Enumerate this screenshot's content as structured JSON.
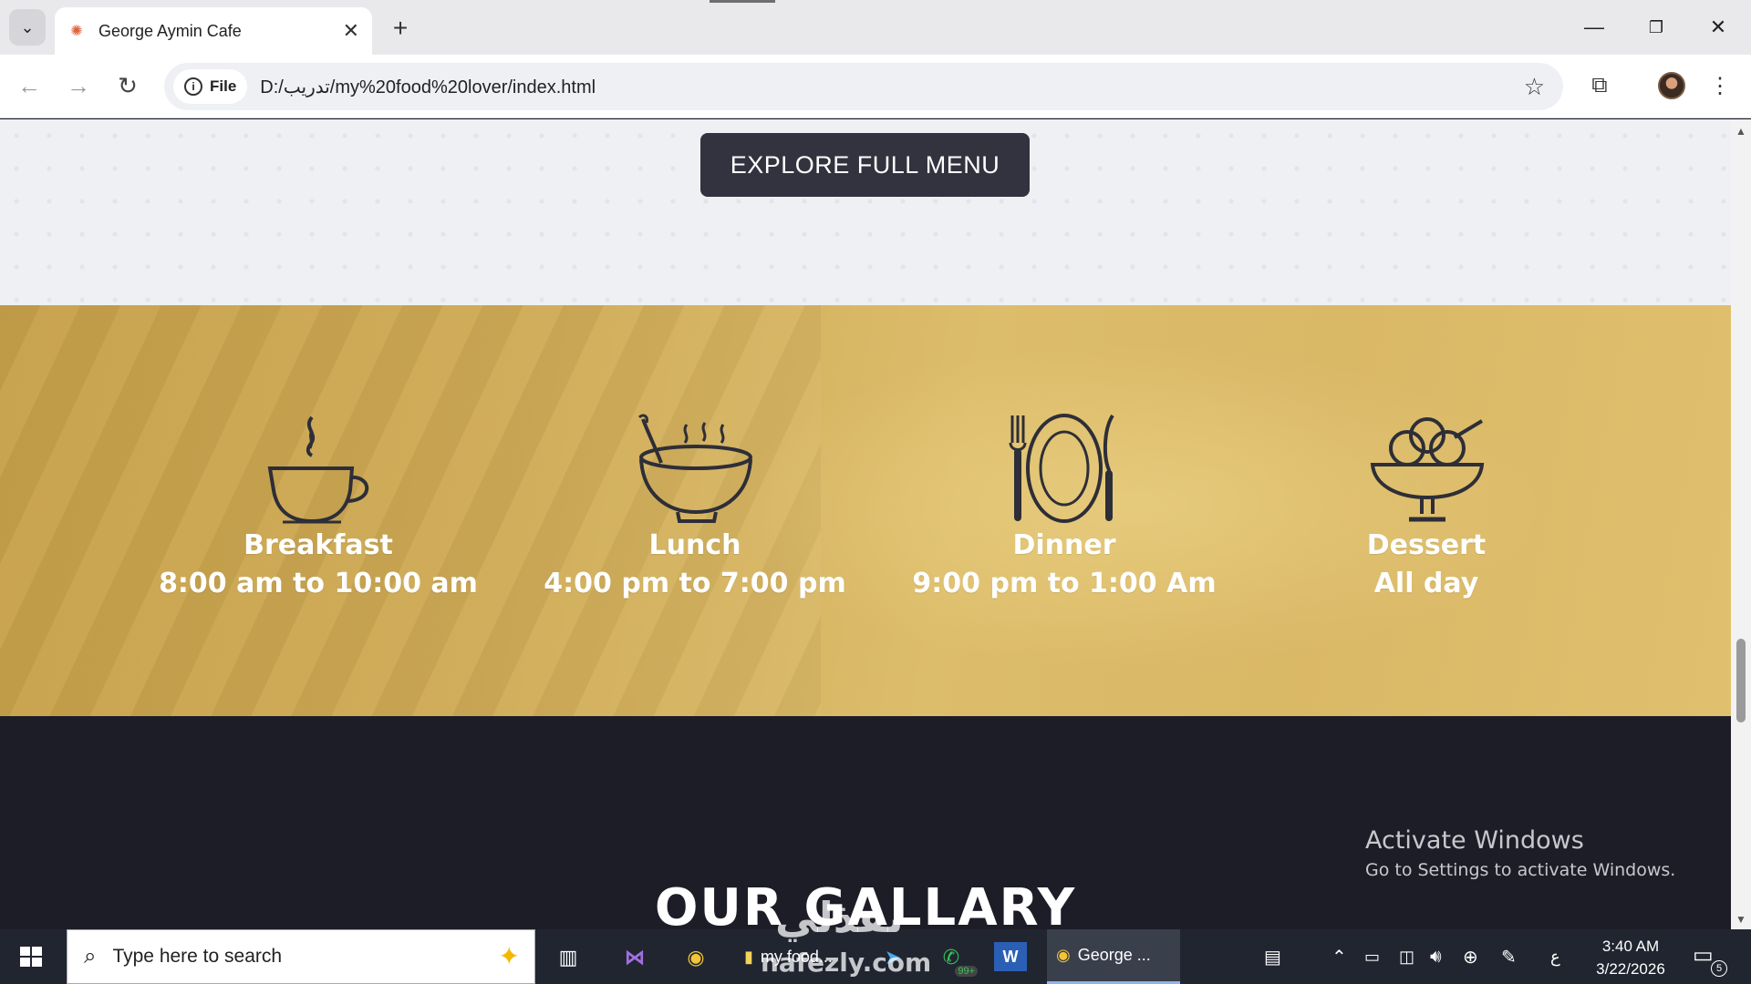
{
  "browser": {
    "tab_title": "George Aymin Cafe",
    "url_chip": "File",
    "url": "D:/تدريب/my%20food%20lover/index.html"
  },
  "page": {
    "explore_button": "EXPLORE FULL MENU",
    "hours": [
      {
        "icon": "coffee-cup-icon",
        "name": "Breakfast",
        "time": "8:00 am to 10:00 am"
      },
      {
        "icon": "soup-bowl-icon",
        "name": "Lunch",
        "time": "4:00 pm to 7:00 pm"
      },
      {
        "icon": "plate-cutlery-icon",
        "name": "Dinner",
        "time": "9:00 pm to 1:00 Am"
      },
      {
        "icon": "ice-cream-bowl-icon",
        "name": "Dessert",
        "time": "All day"
      }
    ],
    "gallery_title": "OUR GALLARY"
  },
  "os_overlay": {
    "activate_title": "Activate Windows",
    "activate_sub": "Go to Settings to activate Windows.",
    "watermark_ar": "نفذلي",
    "watermark_en": "nafezly.com"
  },
  "taskbar": {
    "search_placeholder": "Type here to search",
    "app_folder_label": "my food...",
    "app_chrome_label": "George ...",
    "whatsapp_badge": "99+",
    "lang": "ع",
    "time": "3:40 AM",
    "date": "3/22/2026",
    "notification_count": "5"
  },
  "colors": {
    "hours_band": "#d2b05c",
    "dark_band": "#1d1d28",
    "button": "#33333f",
    "icon_stroke": "#2e2e38"
  }
}
